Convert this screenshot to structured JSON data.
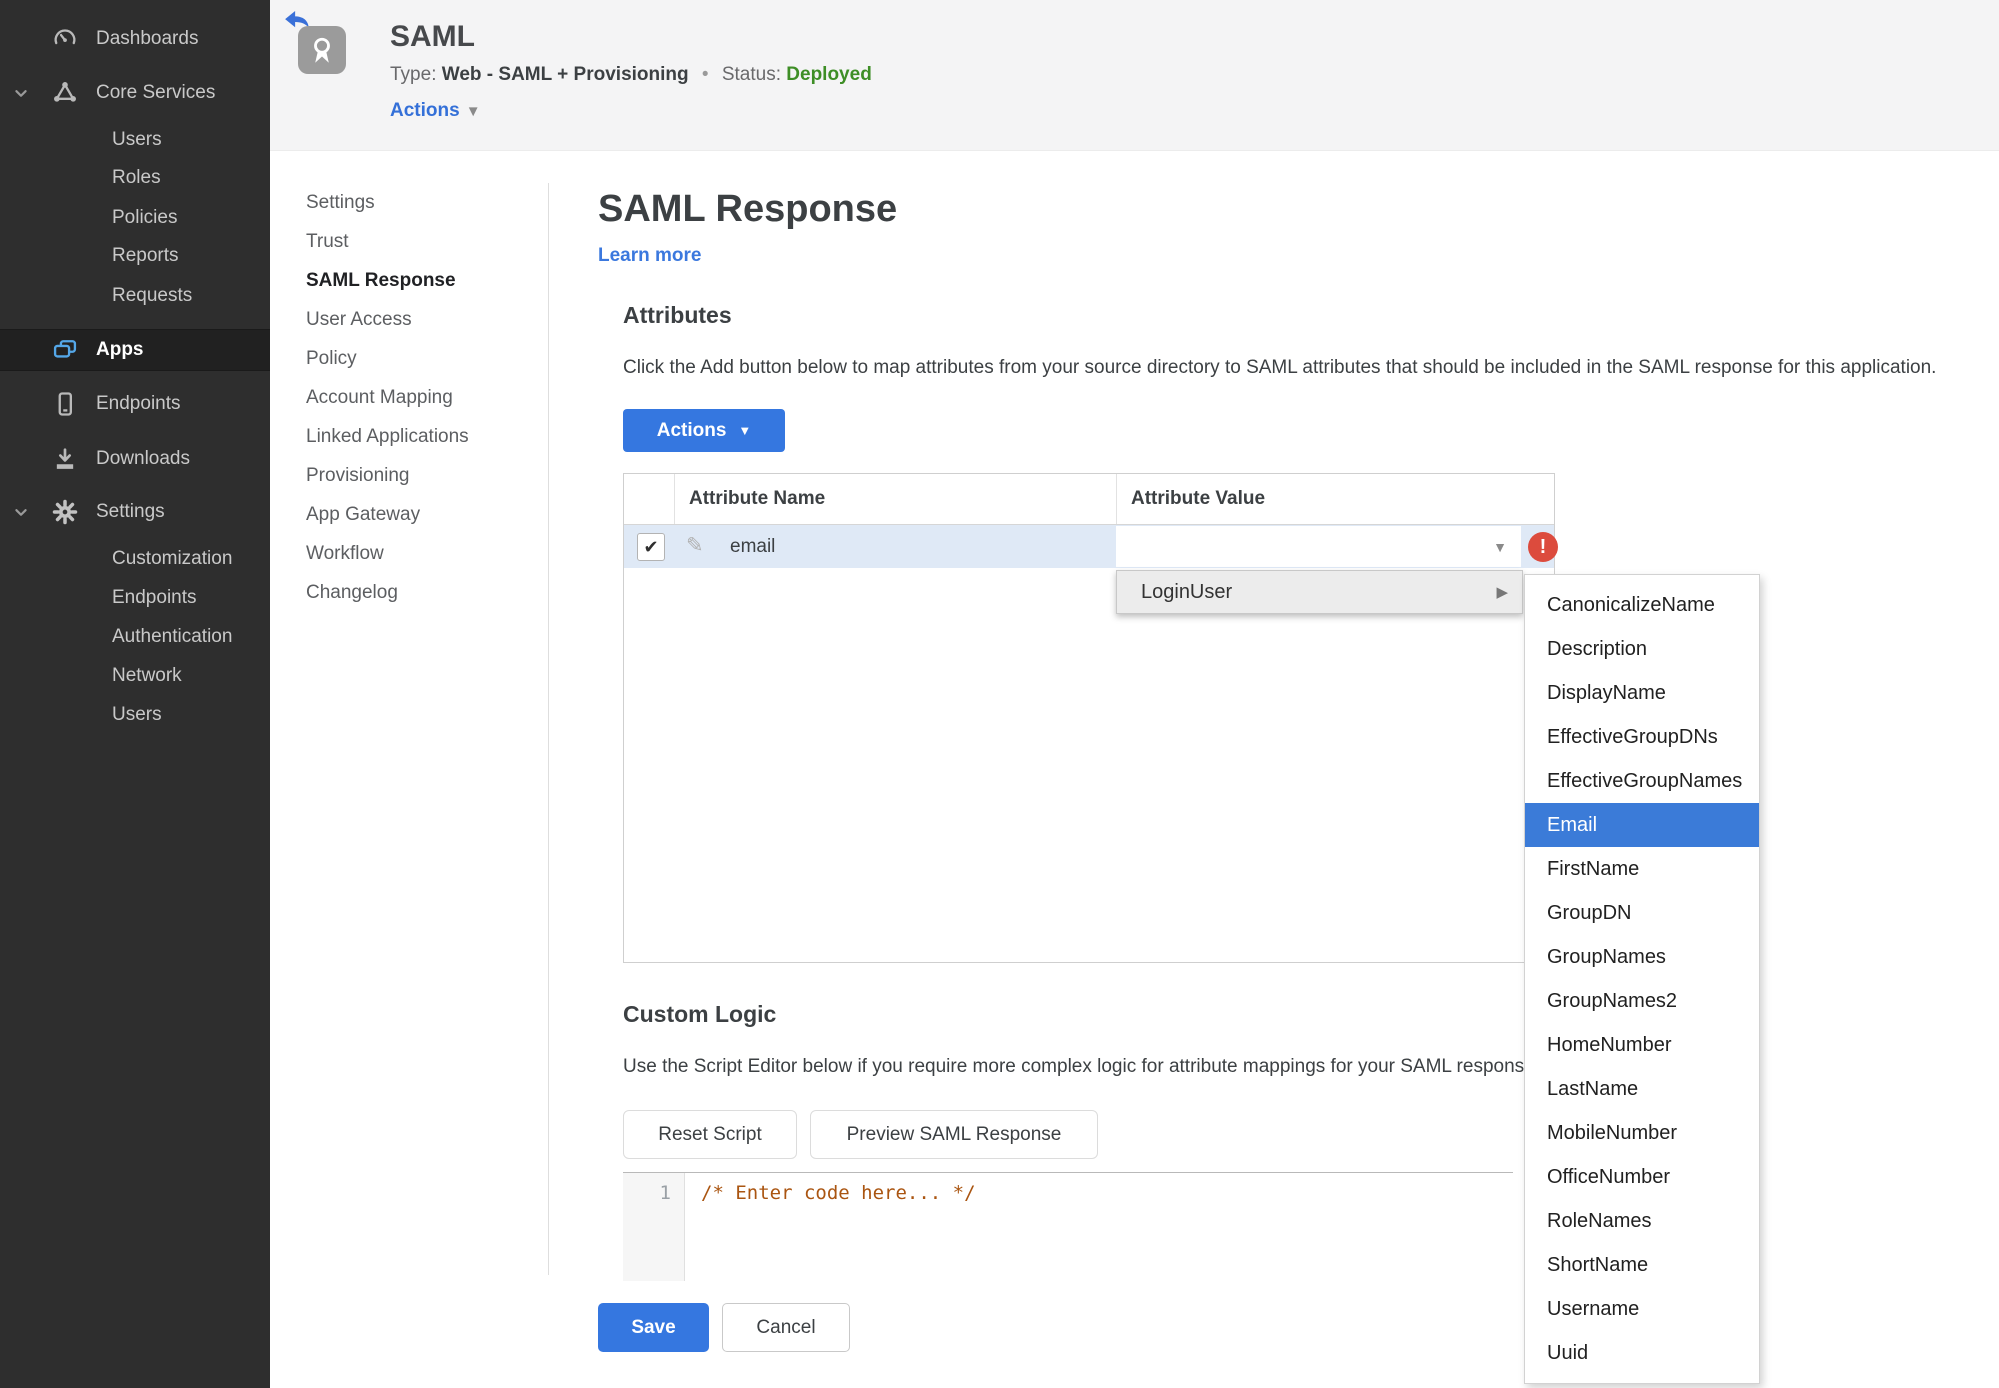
{
  "colors": {
    "accent_blue": "#3577e0",
    "selection_blue": "#3b7bd8",
    "status_green": "#3e8e26",
    "error_red": "#dc4b3d",
    "sidebar_bg": "#2e2e2e",
    "row_highlight": "#dfe9f6"
  },
  "sidebar": {
    "items": [
      {
        "label": "Dashboards",
        "icon": "gauge-icon"
      },
      {
        "label": "Core Services",
        "icon": "core-services-icon"
      },
      {
        "label": "Users"
      },
      {
        "label": "Roles"
      },
      {
        "label": "Policies"
      },
      {
        "label": "Reports"
      },
      {
        "label": "Requests"
      },
      {
        "label": "Apps",
        "icon": "apps-icon"
      },
      {
        "label": "Endpoints",
        "icon": "phone-icon"
      },
      {
        "label": "Downloads",
        "icon": "download-icon"
      },
      {
        "label": "Settings",
        "icon": "gear-icon"
      },
      {
        "label": "Customization"
      },
      {
        "label": "Endpoints"
      },
      {
        "label": "Authentication"
      },
      {
        "label": "Network"
      },
      {
        "label": "Users"
      }
    ]
  },
  "header": {
    "app_title": "SAML",
    "type_label": "Type:",
    "type_value": "Web - SAML + Provisioning",
    "separator": "•",
    "status_label": "Status:",
    "status_value": "Deployed",
    "actions_label": "Actions",
    "badge_icon": "award-ribbon-icon",
    "back_icon": "back-arrow-icon"
  },
  "subnav": {
    "items": [
      {
        "label": "Settings"
      },
      {
        "label": "Trust"
      },
      {
        "label": "SAML Response",
        "active": true
      },
      {
        "label": "User Access"
      },
      {
        "label": "Policy"
      },
      {
        "label": "Account Mapping"
      },
      {
        "label": "Linked Applications"
      },
      {
        "label": "Provisioning"
      },
      {
        "label": "App Gateway"
      },
      {
        "label": "Workflow"
      },
      {
        "label": "Changelog"
      }
    ]
  },
  "main": {
    "title": "SAML Response",
    "learn_more": "Learn more",
    "attributes": {
      "heading": "Attributes",
      "description": "Click the Add button below to map attributes from your source directory to SAML attributes that should be included in the SAML response for this application.",
      "actions_button": "Actions",
      "table": {
        "columns": [
          "Attribute Name",
          "Attribute Value"
        ],
        "rows": [
          {
            "name": "email",
            "checked": true,
            "value": ""
          }
        ]
      }
    },
    "value_menu": {
      "parent": "LoginUser",
      "selected": "Email",
      "options": [
        "CanonicalizeName",
        "Description",
        "DisplayName",
        "EffectiveGroupDNs",
        "EffectiveGroupNames",
        "Email",
        "FirstName",
        "GroupDN",
        "GroupNames",
        "GroupNames2",
        "HomeNumber",
        "LastName",
        "MobileNumber",
        "OfficeNumber",
        "RoleNames",
        "ShortName",
        "Username",
        "Uuid"
      ]
    },
    "custom_logic": {
      "heading": "Custom Logic",
      "description": "Use the Script Editor below if you require more complex logic for attribute mappings for your SAML response.",
      "reset_button": "Reset Script",
      "preview_button": "Preview SAML Response",
      "editor": {
        "line_number": "1",
        "code": "/* Enter code here... */"
      }
    },
    "footer": {
      "save": "Save",
      "cancel": "Cancel"
    }
  }
}
